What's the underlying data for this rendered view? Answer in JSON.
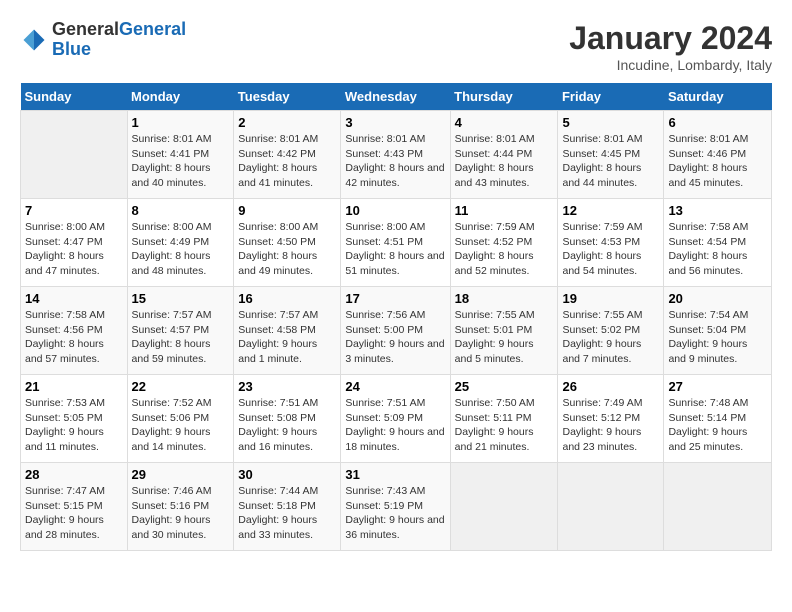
{
  "header": {
    "logo_line1": "General",
    "logo_line2": "Blue",
    "month": "January 2024",
    "location": "Incudine, Lombardy, Italy"
  },
  "weekdays": [
    "Sunday",
    "Monday",
    "Tuesday",
    "Wednesday",
    "Thursday",
    "Friday",
    "Saturday"
  ],
  "weeks": [
    [
      {
        "day": "",
        "sunrise": "",
        "sunset": "",
        "daylight": ""
      },
      {
        "day": "1",
        "sunrise": "8:01 AM",
        "sunset": "4:41 PM",
        "daylight": "8 hours and 40 minutes."
      },
      {
        "day": "2",
        "sunrise": "8:01 AM",
        "sunset": "4:42 PM",
        "daylight": "8 hours and 41 minutes."
      },
      {
        "day": "3",
        "sunrise": "8:01 AM",
        "sunset": "4:43 PM",
        "daylight": "8 hours and 42 minutes."
      },
      {
        "day": "4",
        "sunrise": "8:01 AM",
        "sunset": "4:44 PM",
        "daylight": "8 hours and 43 minutes."
      },
      {
        "day": "5",
        "sunrise": "8:01 AM",
        "sunset": "4:45 PM",
        "daylight": "8 hours and 44 minutes."
      },
      {
        "day": "6",
        "sunrise": "8:01 AM",
        "sunset": "4:46 PM",
        "daylight": "8 hours and 45 minutes."
      }
    ],
    [
      {
        "day": "7",
        "sunrise": "8:00 AM",
        "sunset": "4:47 PM",
        "daylight": "8 hours and 47 minutes."
      },
      {
        "day": "8",
        "sunrise": "8:00 AM",
        "sunset": "4:49 PM",
        "daylight": "8 hours and 48 minutes."
      },
      {
        "day": "9",
        "sunrise": "8:00 AM",
        "sunset": "4:50 PM",
        "daylight": "8 hours and 49 minutes."
      },
      {
        "day": "10",
        "sunrise": "8:00 AM",
        "sunset": "4:51 PM",
        "daylight": "8 hours and 51 minutes."
      },
      {
        "day": "11",
        "sunrise": "7:59 AM",
        "sunset": "4:52 PM",
        "daylight": "8 hours and 52 minutes."
      },
      {
        "day": "12",
        "sunrise": "7:59 AM",
        "sunset": "4:53 PM",
        "daylight": "8 hours and 54 minutes."
      },
      {
        "day": "13",
        "sunrise": "7:58 AM",
        "sunset": "4:54 PM",
        "daylight": "8 hours and 56 minutes."
      }
    ],
    [
      {
        "day": "14",
        "sunrise": "7:58 AM",
        "sunset": "4:56 PM",
        "daylight": "8 hours and 57 minutes."
      },
      {
        "day": "15",
        "sunrise": "7:57 AM",
        "sunset": "4:57 PM",
        "daylight": "8 hours and 59 minutes."
      },
      {
        "day": "16",
        "sunrise": "7:57 AM",
        "sunset": "4:58 PM",
        "daylight": "9 hours and 1 minute."
      },
      {
        "day": "17",
        "sunrise": "7:56 AM",
        "sunset": "5:00 PM",
        "daylight": "9 hours and 3 minutes."
      },
      {
        "day": "18",
        "sunrise": "7:55 AM",
        "sunset": "5:01 PM",
        "daylight": "9 hours and 5 minutes."
      },
      {
        "day": "19",
        "sunrise": "7:55 AM",
        "sunset": "5:02 PM",
        "daylight": "9 hours and 7 minutes."
      },
      {
        "day": "20",
        "sunrise": "7:54 AM",
        "sunset": "5:04 PM",
        "daylight": "9 hours and 9 minutes."
      }
    ],
    [
      {
        "day": "21",
        "sunrise": "7:53 AM",
        "sunset": "5:05 PM",
        "daylight": "9 hours and 11 minutes."
      },
      {
        "day": "22",
        "sunrise": "7:52 AM",
        "sunset": "5:06 PM",
        "daylight": "9 hours and 14 minutes."
      },
      {
        "day": "23",
        "sunrise": "7:51 AM",
        "sunset": "5:08 PM",
        "daylight": "9 hours and 16 minutes."
      },
      {
        "day": "24",
        "sunrise": "7:51 AM",
        "sunset": "5:09 PM",
        "daylight": "9 hours and 18 minutes."
      },
      {
        "day": "25",
        "sunrise": "7:50 AM",
        "sunset": "5:11 PM",
        "daylight": "9 hours and 21 minutes."
      },
      {
        "day": "26",
        "sunrise": "7:49 AM",
        "sunset": "5:12 PM",
        "daylight": "9 hours and 23 minutes."
      },
      {
        "day": "27",
        "sunrise": "7:48 AM",
        "sunset": "5:14 PM",
        "daylight": "9 hours and 25 minutes."
      }
    ],
    [
      {
        "day": "28",
        "sunrise": "7:47 AM",
        "sunset": "5:15 PM",
        "daylight": "9 hours and 28 minutes."
      },
      {
        "day": "29",
        "sunrise": "7:46 AM",
        "sunset": "5:16 PM",
        "daylight": "9 hours and 30 minutes."
      },
      {
        "day": "30",
        "sunrise": "7:44 AM",
        "sunset": "5:18 PM",
        "daylight": "9 hours and 33 minutes."
      },
      {
        "day": "31",
        "sunrise": "7:43 AM",
        "sunset": "5:19 PM",
        "daylight": "9 hours and 36 minutes."
      },
      {
        "day": "",
        "sunrise": "",
        "sunset": "",
        "daylight": ""
      },
      {
        "day": "",
        "sunrise": "",
        "sunset": "",
        "daylight": ""
      },
      {
        "day": "",
        "sunrise": "",
        "sunset": "",
        "daylight": ""
      }
    ]
  ]
}
